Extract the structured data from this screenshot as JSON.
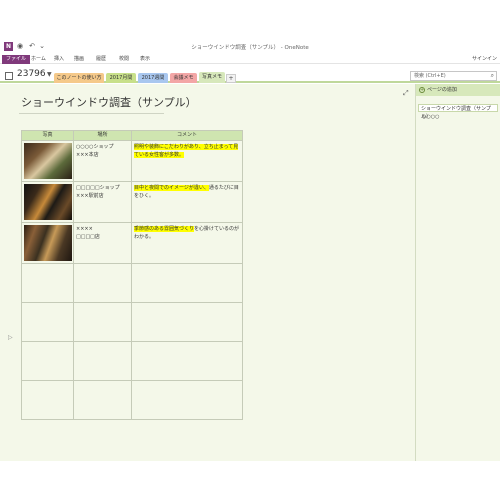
{
  "window": {
    "app_icon": "N",
    "title": "ショーウインドウ調査（サンプル） - OneNote",
    "quick_access": [
      "back-icon",
      "undo-icon",
      "more-icon"
    ]
  },
  "ribbon": {
    "tabs": [
      "ファイル",
      "ホーム",
      "挿入",
      "描画",
      "履歴",
      "校閲",
      "表示"
    ],
    "signin": "サインイン"
  },
  "notebook": {
    "name": "23796"
  },
  "sections": [
    {
      "label": "このノートの使い方",
      "color": "#f5c98a"
    },
    {
      "label": "2017月間",
      "color": "#c8e08a"
    },
    {
      "label": "2017週間",
      "color": "#a9c7ef"
    },
    {
      "label": "会議メモ",
      "color": "#f3a6a6"
    },
    {
      "label": "写真メモ",
      "color": "#d7e8bb"
    }
  ],
  "search": {
    "placeholder": "検索 (Ctrl+E)"
  },
  "page": {
    "title": "ショーウインドウ調査（サンプル）"
  },
  "table": {
    "headers": [
      "写真",
      "場所",
      "コメント"
    ],
    "rows": [
      {
        "photo": "photo1",
        "place_line1": "○○○○ショップ",
        "place_line2": "×××本店",
        "comment_hl": "照明や装飾にこだわりがあり、立ち止まって見ている女性客が多数。",
        "comment_rest": ""
      },
      {
        "photo": "photo2",
        "place_line1": "□□□□□ショップ",
        "place_line2": "×××駅前店",
        "comment_hl": "目中と夜間でのイメージが違い、",
        "comment_rest": "通るたびに目をひく。"
      },
      {
        "photo": "photo3",
        "place_line1": "××××",
        "place_line2": "□□□□店",
        "comment_hl": "季節感のある雰囲気づくり",
        "comment_rest": "を心掛けているのがわかる。"
      }
    ],
    "empty_rows": 4
  },
  "page_pane": {
    "add_page_label": "ページの追加",
    "pages": [
      {
        "label": "ショーウインドウ調査（サンプル）",
        "selected": true
      },
      {
        "label": "○○○○",
        "selected": false
      }
    ]
  }
}
